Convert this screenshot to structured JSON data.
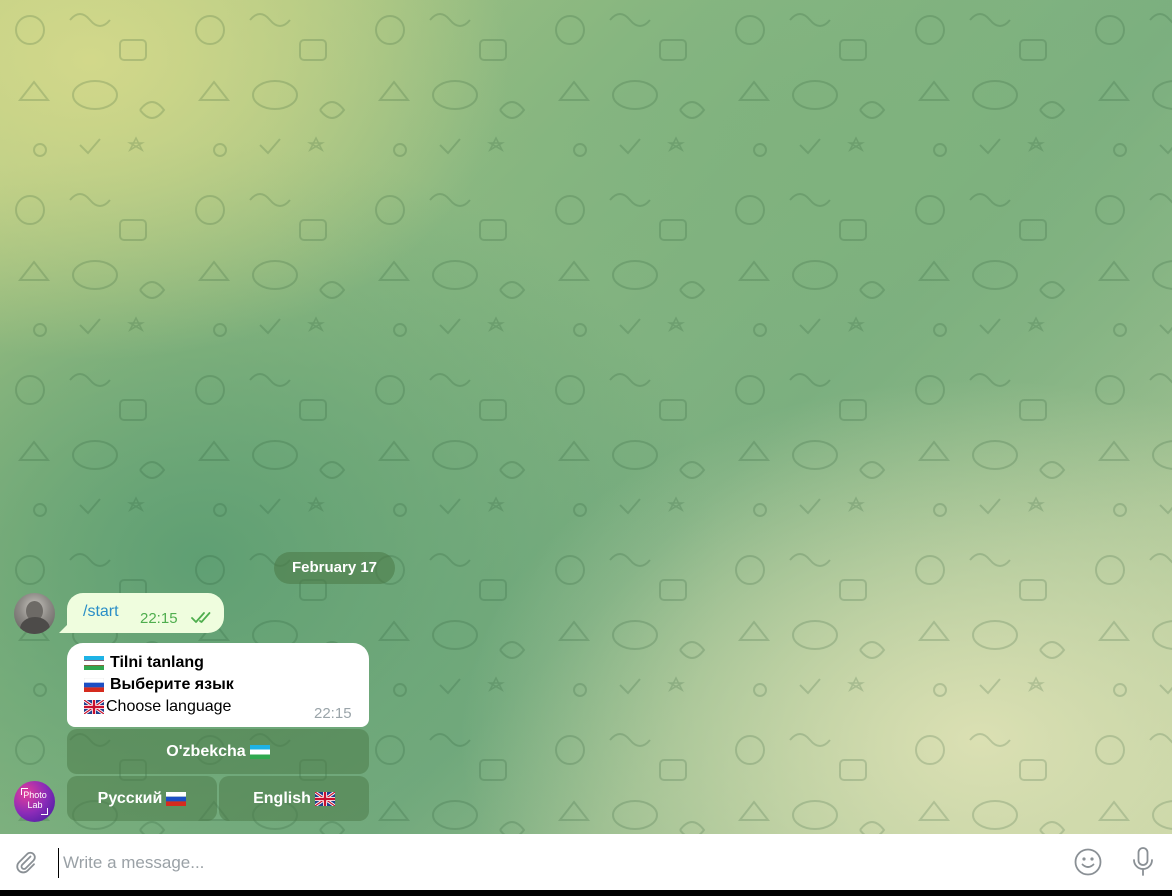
{
  "chat": {
    "date_separator": "February 17",
    "outgoing_message": {
      "text": "/start",
      "time": "22:15",
      "status_icon": "double-check-icon"
    },
    "bot_message": {
      "lines": [
        {
          "flag": "uzbekistan-flag-icon",
          "text": "Tilni tanlang"
        },
        {
          "flag": "russia-flag-icon",
          "text": "Выберите язык"
        },
        {
          "flag": "uk-flag-icon",
          "text": "Choose language"
        }
      ],
      "time": "22:15"
    },
    "keyboard": {
      "uzbek_label": "O'zbekcha",
      "russian_label": "Русский",
      "english_label": "English"
    },
    "bot_avatar_text": "Photo Lab"
  },
  "composer": {
    "placeholder": "Write a message...",
    "attach_icon": "paperclip-icon",
    "emoji_icon": "smile-icon",
    "mic_icon": "microphone-icon"
  },
  "colors": {
    "outgoing_bubble": "#effdde",
    "incoming_bubble": "#ffffff",
    "command_link": "#2a8ec7",
    "read_check": "#4fae4e"
  }
}
